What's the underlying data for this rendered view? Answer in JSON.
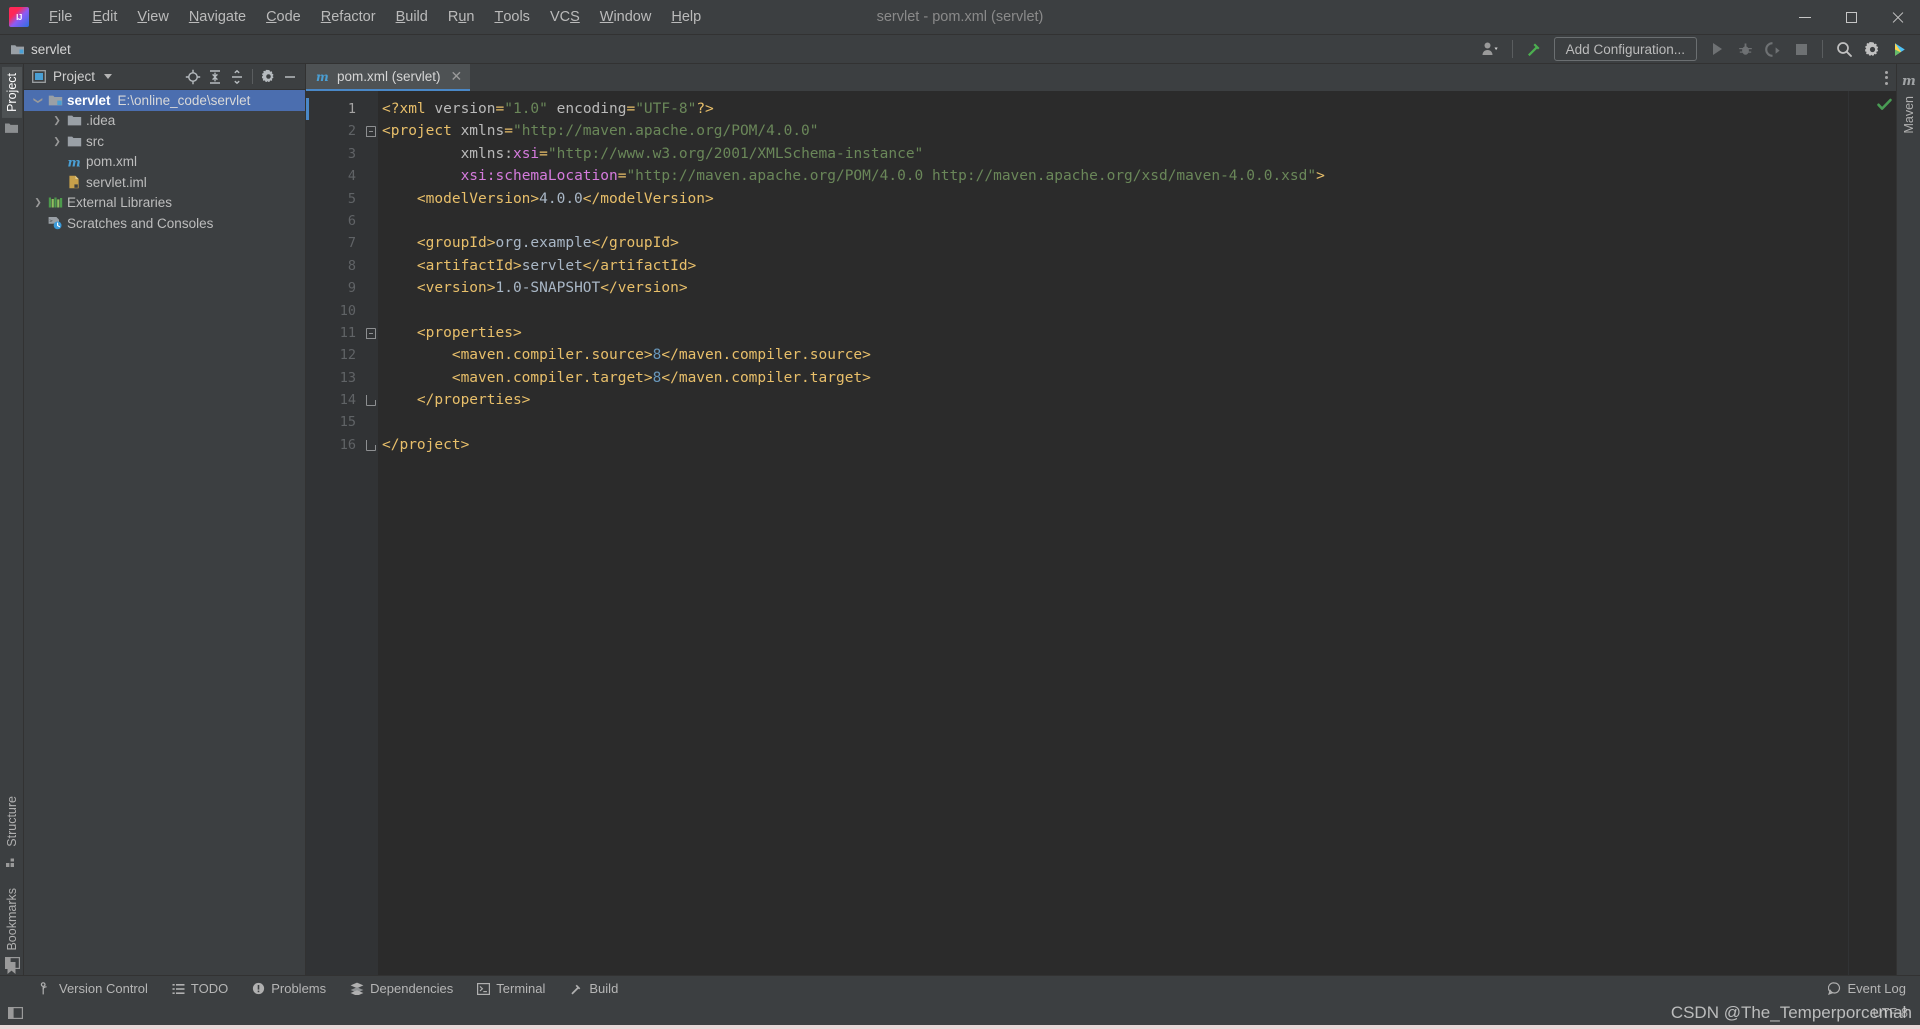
{
  "window": {
    "title": "servlet - pom.xml (servlet)",
    "app_icon": "intellij-idea-logo",
    "controls": {
      "minimize": "minimize-icon",
      "maximize": "maximize-icon",
      "close": "close-icon"
    }
  },
  "menu": {
    "items": [
      {
        "label": "File",
        "mnemonic": "F"
      },
      {
        "label": "Edit",
        "mnemonic": "E"
      },
      {
        "label": "View",
        "mnemonic": "V"
      },
      {
        "label": "Navigate",
        "mnemonic": "N"
      },
      {
        "label": "Code",
        "mnemonic": "C"
      },
      {
        "label": "Refactor",
        "mnemonic": "R"
      },
      {
        "label": "Build",
        "mnemonic": "B"
      },
      {
        "label": "Run",
        "mnemonic": "u"
      },
      {
        "label": "Tools",
        "mnemonic": "T"
      },
      {
        "label": "VCS",
        "mnemonic": "S"
      },
      {
        "label": "Window",
        "mnemonic": "W"
      },
      {
        "label": "Help",
        "mnemonic": "H"
      }
    ]
  },
  "navbar": {
    "breadcrumb": "servlet",
    "breadcrumb_icon": "project-folder-icon",
    "run_config_label": "Add Configuration...",
    "buttons": [
      {
        "name": "user-account-icon",
        "label": ""
      },
      {
        "name": "build-hammer-icon",
        "label": ""
      },
      {
        "name": "run-icon",
        "label": ""
      },
      {
        "name": "debug-icon",
        "label": ""
      },
      {
        "name": "run-coverage-icon",
        "label": ""
      },
      {
        "name": "stop-icon",
        "label": ""
      },
      {
        "name": "search-everywhere-icon",
        "label": ""
      },
      {
        "name": "settings-gear-icon",
        "label": ""
      },
      {
        "name": "ide-features-icon",
        "label": ""
      }
    ]
  },
  "left_strip": {
    "tabs": [
      {
        "label": "Project",
        "icon": "project-icon",
        "active": true
      },
      {
        "label": "Structure",
        "icon": "structure-icon",
        "active": false
      },
      {
        "label": "Bookmarks",
        "icon": "bookmark-icon",
        "active": false
      }
    ]
  },
  "right_strip": {
    "tabs": [
      {
        "label": "Maven",
        "icon": "maven-m-icon",
        "active": false
      }
    ]
  },
  "project_panel": {
    "title": "Project",
    "title_icon": "project-view-icon",
    "toolbar": [
      {
        "name": "select-opened-file-icon"
      },
      {
        "name": "expand-all-icon"
      },
      {
        "name": "collapse-all-icon"
      },
      {
        "name": "settings-gear-icon"
      },
      {
        "name": "hide-panel-icon"
      }
    ],
    "tree": [
      {
        "label": "servlet",
        "path": "E:\\online_code\\servlet",
        "icon": "module-folder-icon",
        "arrow": "expanded",
        "indent": 0,
        "selected": true
      },
      {
        "label": ".idea",
        "path": "",
        "icon": "folder-icon",
        "arrow": "collapsed",
        "indent": 1,
        "selected": false
      },
      {
        "label": "src",
        "path": "",
        "icon": "folder-icon",
        "arrow": "collapsed",
        "indent": 1,
        "selected": false
      },
      {
        "label": "pom.xml",
        "path": "",
        "icon": "maven-m-icon",
        "arrow": "none",
        "indent": 1,
        "selected": false
      },
      {
        "label": "servlet.iml",
        "path": "",
        "icon": "iml-file-icon",
        "arrow": "none",
        "indent": 1,
        "selected": false
      },
      {
        "label": "External Libraries",
        "path": "",
        "icon": "libraries-icon",
        "arrow": "collapsed",
        "indent": 0,
        "selected": false
      },
      {
        "label": "Scratches and Consoles",
        "path": "",
        "icon": "scratches-icon",
        "arrow": "none",
        "indent": 0,
        "selected": false
      }
    ]
  },
  "editor": {
    "tab": {
      "label": "pom.xml (servlet)",
      "icon": "maven-m-icon",
      "close_icon": "close-icon"
    },
    "options_icon": "more-options-icon",
    "inspection_status": "ok-checkmark",
    "current_line": 1,
    "line_count": 16,
    "lines": [
      {
        "n": 1,
        "fold": "none",
        "tokens": [
          {
            "t": "tag",
            "v": "<?xml"
          },
          {
            "t": "plain",
            "v": " "
          },
          {
            "t": "attr",
            "v": "version"
          },
          {
            "t": "tag",
            "v": "="
          },
          {
            "t": "val",
            "v": "\"1.0\""
          },
          {
            "t": "plain",
            "v": " "
          },
          {
            "t": "attr",
            "v": "encoding"
          },
          {
            "t": "tag",
            "v": "="
          },
          {
            "t": "val",
            "v": "\"UTF-8\""
          },
          {
            "t": "tag",
            "v": "?>"
          }
        ]
      },
      {
        "n": 2,
        "fold": "start",
        "tokens": [
          {
            "t": "tag",
            "v": "<project"
          },
          {
            "t": "plain",
            "v": " "
          },
          {
            "t": "attr",
            "v": "xmlns"
          },
          {
            "t": "tag",
            "v": "="
          },
          {
            "t": "val",
            "v": "\"http://maven.apache.org/POM/4.0.0\""
          }
        ]
      },
      {
        "n": 3,
        "fold": "none",
        "tokens": [
          {
            "t": "plain",
            "v": "         "
          },
          {
            "t": "attr",
            "v": "xmlns:"
          },
          {
            "t": "ns",
            "v": "xsi"
          },
          {
            "t": "tag",
            "v": "="
          },
          {
            "t": "val",
            "v": "\"http://www.w3.org/2001/XMLSchema-instance\""
          }
        ]
      },
      {
        "n": 4,
        "fold": "none",
        "tokens": [
          {
            "t": "plain",
            "v": "         "
          },
          {
            "t": "ns",
            "v": "xsi:"
          },
          {
            "t": "ns",
            "v": "schemaLocation"
          },
          {
            "t": "tag",
            "v": "="
          },
          {
            "t": "val",
            "v": "\"http://maven.apache.org/POM/4.0.0 http://maven.apache.org/xsd/maven-4.0.0.xsd\""
          },
          {
            "t": "tag",
            "v": ">"
          }
        ]
      },
      {
        "n": 5,
        "fold": "none",
        "tokens": [
          {
            "t": "plain",
            "v": "    "
          },
          {
            "t": "tag",
            "v": "<modelVersion>"
          },
          {
            "t": "txt",
            "v": "4.0.0"
          },
          {
            "t": "tag",
            "v": "</modelVersion>"
          }
        ]
      },
      {
        "n": 6,
        "fold": "none",
        "tokens": []
      },
      {
        "n": 7,
        "fold": "none",
        "tokens": [
          {
            "t": "plain",
            "v": "    "
          },
          {
            "t": "tag",
            "v": "<groupId>"
          },
          {
            "t": "txt",
            "v": "org.example"
          },
          {
            "t": "tag",
            "v": "</groupId>"
          }
        ]
      },
      {
        "n": 8,
        "fold": "none",
        "tokens": [
          {
            "t": "plain",
            "v": "    "
          },
          {
            "t": "tag",
            "v": "<artifactId>"
          },
          {
            "t": "txt",
            "v": "servlet"
          },
          {
            "t": "tag",
            "v": "</artifactId>"
          }
        ]
      },
      {
        "n": 9,
        "fold": "none",
        "tokens": [
          {
            "t": "plain",
            "v": "    "
          },
          {
            "t": "tag",
            "v": "<version>"
          },
          {
            "t": "txt",
            "v": "1.0-SNAPSHOT"
          },
          {
            "t": "tag",
            "v": "</version>"
          }
        ]
      },
      {
        "n": 10,
        "fold": "none",
        "tokens": []
      },
      {
        "n": 11,
        "fold": "start",
        "tokens": [
          {
            "t": "plain",
            "v": "    "
          },
          {
            "t": "tag",
            "v": "<properties>"
          }
        ]
      },
      {
        "n": 12,
        "fold": "none",
        "tokens": [
          {
            "t": "plain",
            "v": "        "
          },
          {
            "t": "tag",
            "v": "<maven.compiler.source>"
          },
          {
            "t": "num",
            "v": "8"
          },
          {
            "t": "tag",
            "v": "</maven.compiler.source>"
          }
        ]
      },
      {
        "n": 13,
        "fold": "none",
        "tokens": [
          {
            "t": "plain",
            "v": "        "
          },
          {
            "t": "tag",
            "v": "<maven.compiler.target>"
          },
          {
            "t": "num",
            "v": "8"
          },
          {
            "t": "tag",
            "v": "</maven.compiler.target>"
          }
        ]
      },
      {
        "n": 14,
        "fold": "end",
        "tokens": [
          {
            "t": "plain",
            "v": "    "
          },
          {
            "t": "tag",
            "v": "</properties>"
          }
        ]
      },
      {
        "n": 15,
        "fold": "none",
        "tokens": []
      },
      {
        "n": 16,
        "fold": "end",
        "tokens": [
          {
            "t": "tag",
            "v": "</project>"
          }
        ]
      }
    ]
  },
  "tool_window_bar": {
    "items": [
      {
        "label": "Version Control",
        "icon": "branch-icon"
      },
      {
        "label": "TODO",
        "icon": "todo-list-icon"
      },
      {
        "label": "Problems",
        "icon": "problems-icon"
      },
      {
        "label": "Dependencies",
        "icon": "dependencies-icon"
      },
      {
        "label": "Terminal",
        "icon": "terminal-icon"
      },
      {
        "label": "Build",
        "icon": "build-hammer-icon"
      }
    ],
    "event_log": {
      "label": "Event Log",
      "icon": "event-log-icon"
    }
  },
  "status_bar": {
    "watermark": "CSDN @The_Temperporcemah",
    "encoding": "UTF-8"
  },
  "colors": {
    "accent_blue": "#4b6eaf",
    "tab_underline": "#4a88c7",
    "editor_bg": "#2b2b2b",
    "panel_bg": "#3c3f41",
    "gutter_bg": "#313335",
    "ok_green": "#499c54",
    "xml_tag": "#e8bf6a",
    "xml_value": "#6a8759",
    "xml_ns": "#d57bdd",
    "xml_text": "#a9b7c6",
    "xml_number": "#6897bb"
  }
}
